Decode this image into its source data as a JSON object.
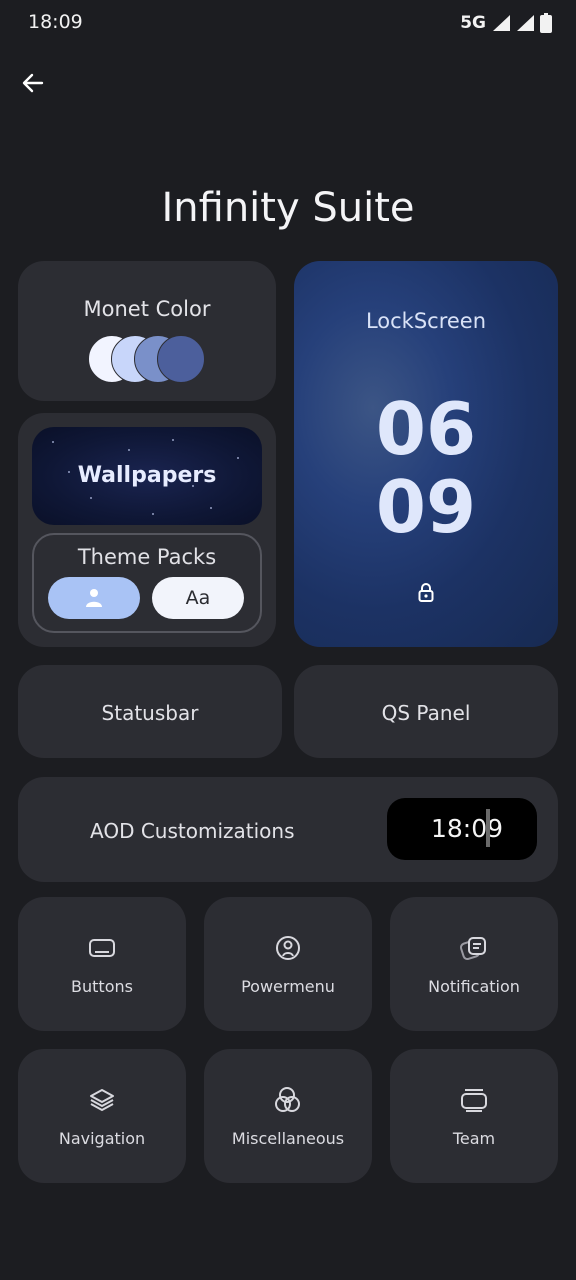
{
  "status_bar": {
    "time": "18:09",
    "network": "5G"
  },
  "header": {
    "title": "Infinity Suite"
  },
  "monet": {
    "title": "Monet Color",
    "swatches": [
      "#f2f4ff",
      "#c8d6fa",
      "#7a90c9",
      "#4c5f9c"
    ]
  },
  "lockscreen": {
    "title": "LockScreen",
    "hour": "06",
    "minute": "09"
  },
  "wallpapers": {
    "label": "Wallpapers"
  },
  "theme_packs": {
    "title": "Theme Packs",
    "font_sample": "Aa"
  },
  "statusbar_tile": {
    "label": "Statusbar"
  },
  "qs_tile": {
    "label": "QS Panel"
  },
  "aod": {
    "label": "AOD Customizations",
    "time": "18:09"
  },
  "tiles": [
    {
      "label": "Buttons",
      "icon": "buttons-icon"
    },
    {
      "label": "Powermenu",
      "icon": "power-icon"
    },
    {
      "label": "Notification",
      "icon": "notification-icon"
    },
    {
      "label": "Navigation",
      "icon": "layers-icon"
    },
    {
      "label": "Miscellaneous",
      "icon": "circles-icon"
    },
    {
      "label": "Team",
      "icon": "team-icon"
    }
  ],
  "colors": {
    "background": "#1c1d21",
    "card": "#2c2d33",
    "accent": "#a9c3f5"
  }
}
